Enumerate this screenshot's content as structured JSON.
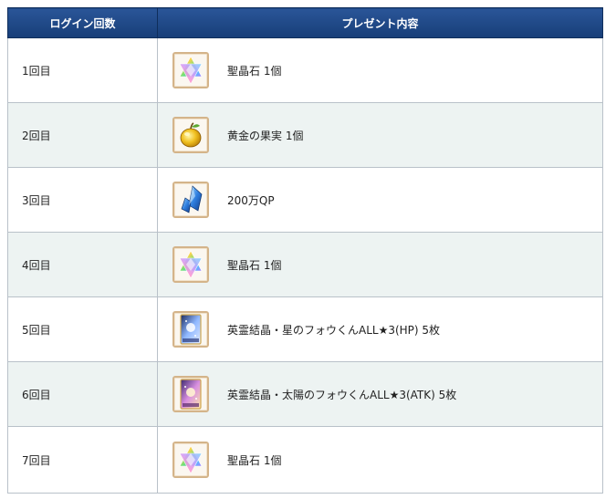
{
  "table": {
    "headers": {
      "login_count": "ログイン回数",
      "present": "プレゼント内容"
    },
    "rows": [
      {
        "day": "1回目",
        "item": "聖晶石 1個",
        "icon": "saint-quartz-icon"
      },
      {
        "day": "2回目",
        "item": "黄金の果実 1個",
        "icon": "golden-apple-icon"
      },
      {
        "day": "3回目",
        "item": "200万QP",
        "icon": "qp-crystal-icon"
      },
      {
        "day": "4回目",
        "item": "聖晶石 1個",
        "icon": "saint-quartz-icon"
      },
      {
        "day": "5回目",
        "item": "英霊結晶・星のフォウくんALL★3(HP) 5枚",
        "icon": "fou-card-hp-icon"
      },
      {
        "day": "6回目",
        "item": "英霊結晶・太陽のフォウくんALL★3(ATK) 5枚",
        "icon": "fou-card-atk-icon"
      },
      {
        "day": "7回目",
        "item": "聖晶石 1個",
        "icon": "saint-quartz-icon"
      }
    ]
  }
}
